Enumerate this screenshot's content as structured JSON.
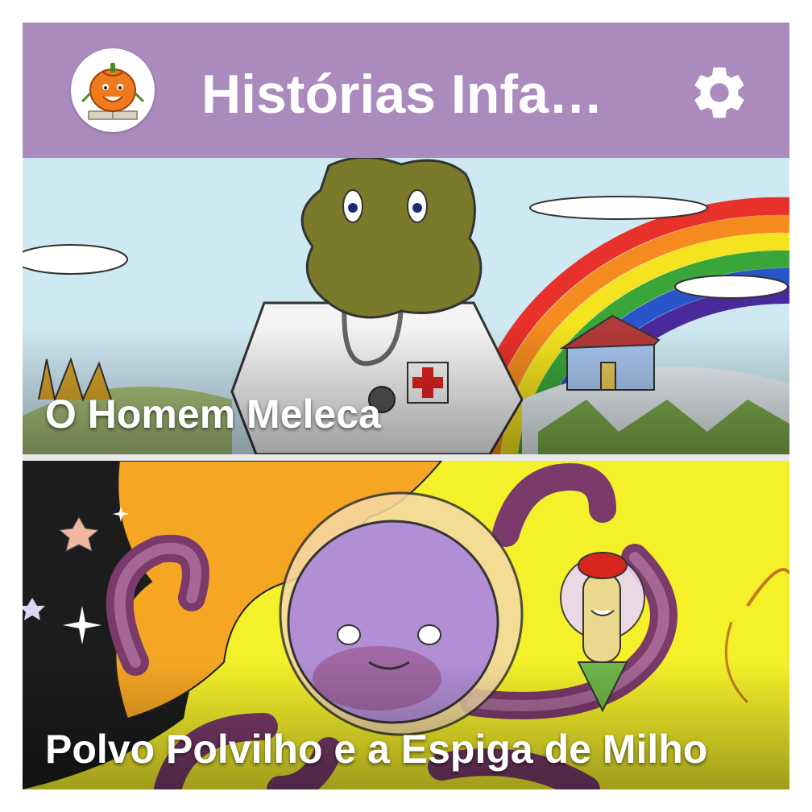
{
  "app": {
    "title": "Histórias Infa…",
    "logo_icon": "pumpkin-book-logo",
    "settings_icon": "gear-icon",
    "colors": {
      "toolbar": "#ab8abd",
      "title": "#ffffff"
    }
  },
  "stories": [
    {
      "title": "O Homem Meleca"
    },
    {
      "title": "Polvo Polvilho e a Espiga de Milho"
    }
  ]
}
